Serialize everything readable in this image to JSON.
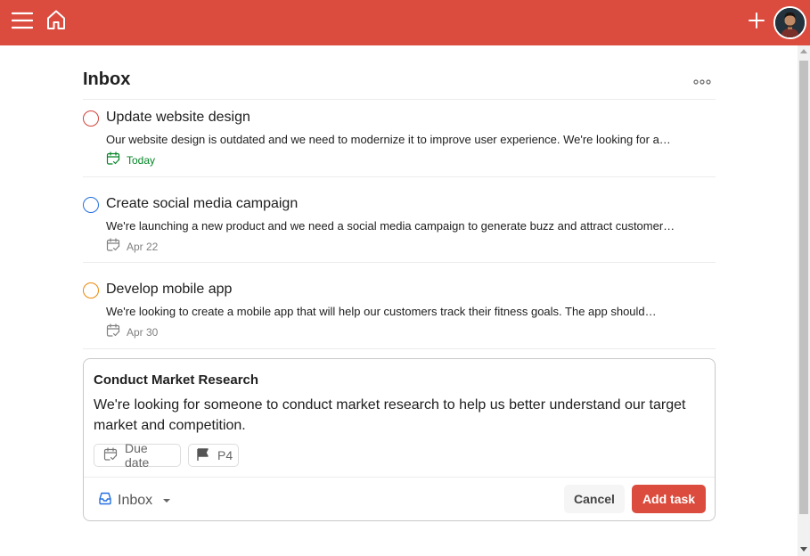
{
  "header": {
    "menu_icon": "hamburger-menu-icon",
    "home_icon": "home-icon",
    "add_icon": "plus-icon",
    "avatar": "user-avatar",
    "color": "#db4c3f"
  },
  "page": {
    "title": "Inbox",
    "more_icon": "ellipsis-icon"
  },
  "tasks": [
    {
      "title": "Update website design",
      "description": "Our website design is outdated and we need to modernize it to improve user experience. We're looking for a…",
      "due": "Today",
      "priority_color": "#d1453b",
      "due_color": "#058527"
    },
    {
      "title": "Create social media campaign",
      "description": "We're launching a new product and we need a social media campaign to generate buzz and attract customer…",
      "due": "Apr 22",
      "priority_color": "#246fe0",
      "due_color": "#808080"
    },
    {
      "title": "Develop mobile app",
      "description": "We're looking to create a mobile app that will help our customers track their fitness goals. The app should…",
      "due": "Apr 30",
      "priority_color": "#eb8909",
      "due_color": "#808080"
    }
  ],
  "editor": {
    "title": "Conduct Market Research",
    "description": "We're looking for someone to conduct market research to help us better understand our target market and competition.",
    "due_date_label": "Due date",
    "priority_label": "P4",
    "project_label": "Inbox",
    "cancel_label": "Cancel",
    "add_label": "Add task",
    "accent_color": "#dc4c3e"
  }
}
